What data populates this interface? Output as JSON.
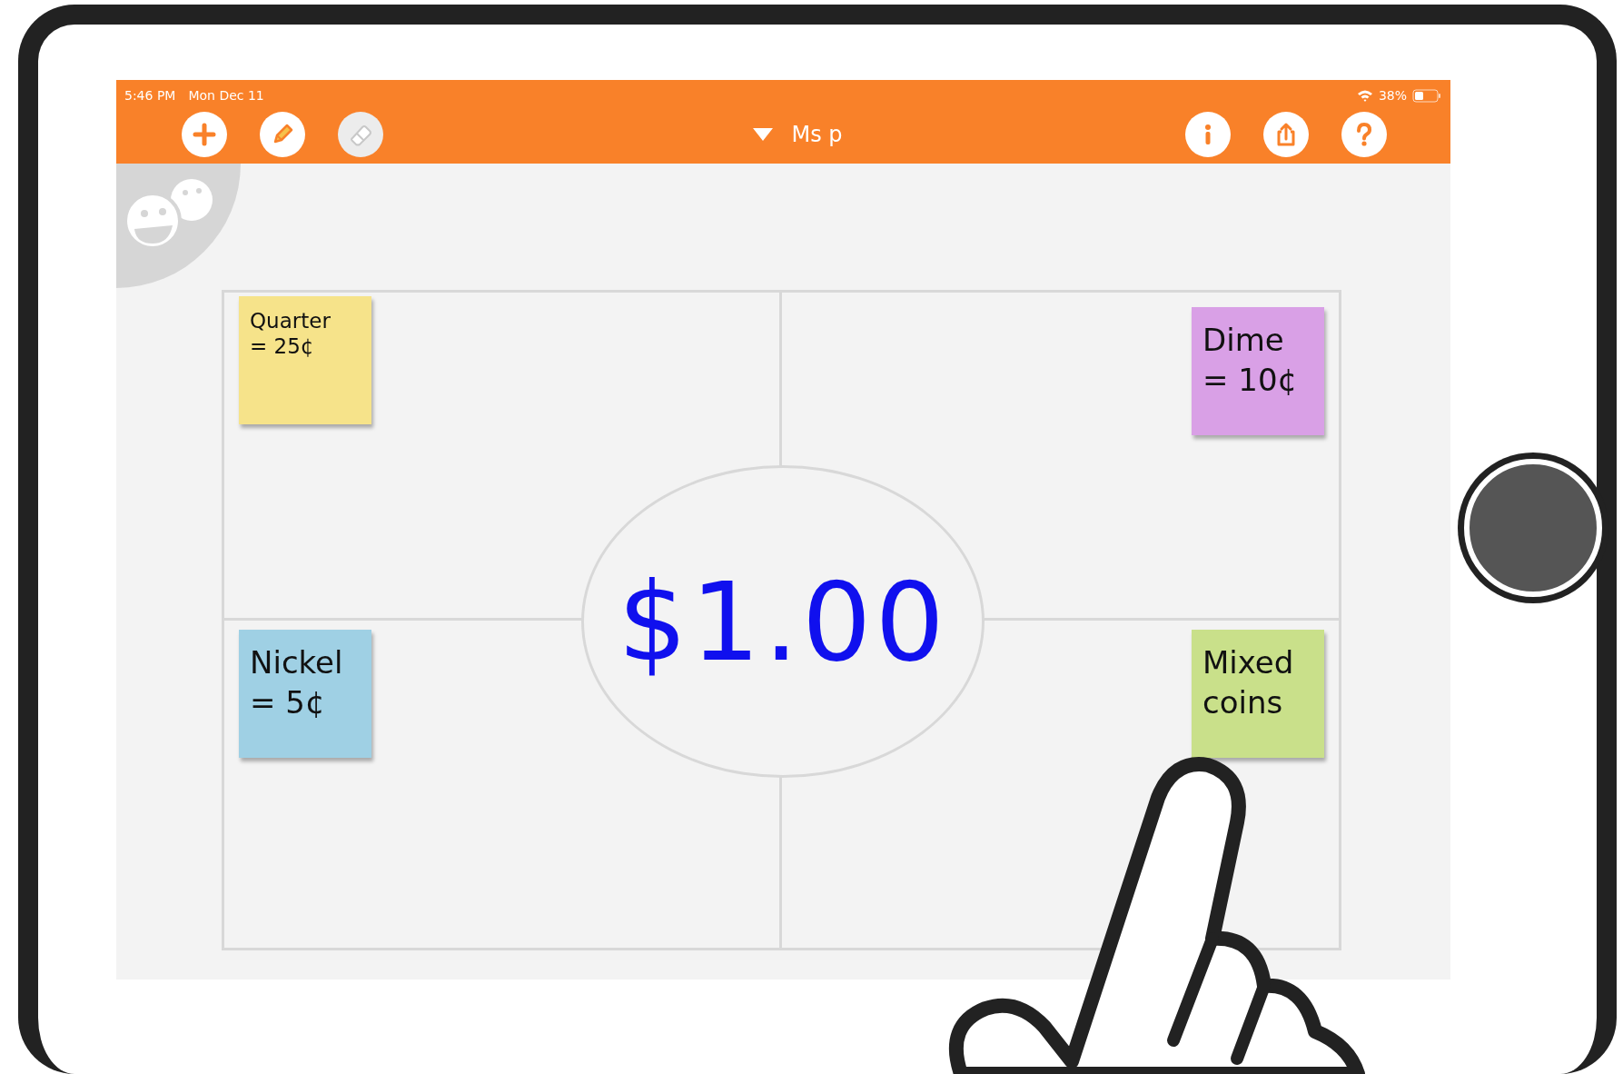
{
  "status_bar": {
    "time": "5:46 PM",
    "date": "Mon Dec 11",
    "battery": "38%"
  },
  "toolbar": {
    "left_buttons": [
      {
        "kind": "add",
        "disabled": false
      },
      {
        "kind": "pen",
        "disabled": false
      },
      {
        "kind": "eraser",
        "disabled": true
      }
    ],
    "title": "Ms p",
    "right_buttons": [
      {
        "kind": "info"
      },
      {
        "kind": "share"
      },
      {
        "kind": "help"
      }
    ]
  },
  "board": {
    "center_ink": "$1.00",
    "notes": [
      {
        "lines": [
          "Quarter",
          "= 25¢"
        ],
        "color": "#f6e38a",
        "kind": "small"
      },
      {
        "lines": [
          "Dime",
          "= 10¢"
        ],
        "color": "#d9a0e6",
        "kind": "large"
      },
      {
        "lines": [
          "Nickel",
          "= 5¢"
        ],
        "color": "#9fd0e4",
        "kind": "large"
      },
      {
        "lines": [
          "Mixed",
          "coins"
        ],
        "color": "#c9e08a",
        "kind": "large"
      }
    ]
  }
}
